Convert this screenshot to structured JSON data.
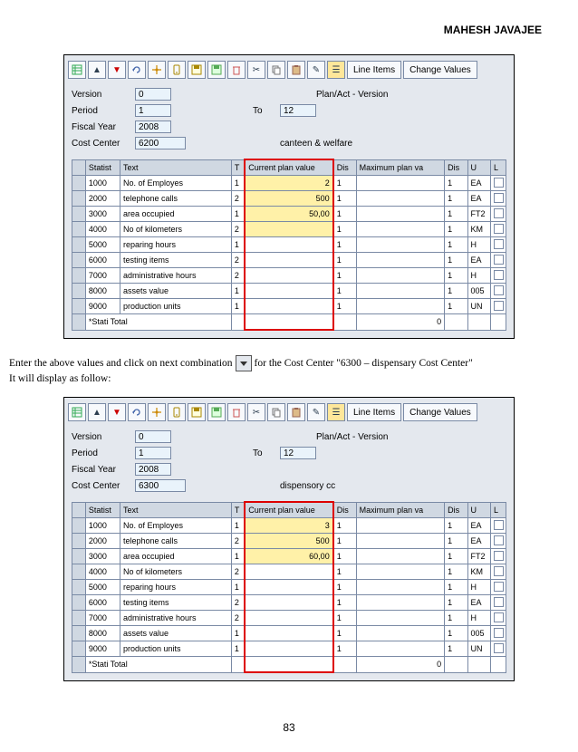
{
  "header": {
    "author": "MAHESH JAVAJEE"
  },
  "footer": {
    "page_number": "83"
  },
  "toolbar": {
    "line_items": "Line Items",
    "change_values": "Change Values"
  },
  "form": {
    "labels": {
      "version": "Version",
      "period": "Period",
      "fiscal_year": "Fiscal Year",
      "cost_center": "Cost Center",
      "to": "To",
      "planact": "Plan/Act - Version"
    }
  },
  "grid_headers": {
    "statist": "Statist",
    "text": "Text",
    "t": "T",
    "cpv": "Current plan value",
    "dis1": "Dis",
    "maxpv": "Maximum plan va",
    "dis2": "Dis",
    "u": "U",
    "l": "L"
  },
  "screen1": {
    "version": "0",
    "period_from": "1",
    "period_to": "12",
    "fiscal_year": "2008",
    "cost_center": "6200",
    "cost_center_text": "canteen & welfare",
    "rows": [
      {
        "id": "1000",
        "text": "No. of Employes",
        "t": "1",
        "cpv": "2",
        "dis1": "1",
        "max": "",
        "dis2": "1",
        "u": "EA",
        "l": ""
      },
      {
        "id": "2000",
        "text": "telephone calls",
        "t": "2",
        "cpv": "500",
        "dis1": "1",
        "max": "",
        "dis2": "1",
        "u": "EA",
        "l": ""
      },
      {
        "id": "3000",
        "text": "area occupied",
        "t": "1",
        "cpv": "50,00",
        "dis1": "1",
        "max": "",
        "dis2": "1",
        "u": "FT2",
        "l": ""
      },
      {
        "id": "4000",
        "text": "No of kilometers",
        "t": "2",
        "cpv": "",
        "dis1": "1",
        "max": "",
        "dis2": "1",
        "u": "KM",
        "l": ""
      },
      {
        "id": "5000",
        "text": "reparing hours",
        "t": "1",
        "cpv": "",
        "dis1": "1",
        "max": "",
        "dis2": "1",
        "u": "H",
        "l": ""
      },
      {
        "id": "6000",
        "text": "testing items",
        "t": "2",
        "cpv": "",
        "dis1": "1",
        "max": "",
        "dis2": "1",
        "u": "EA",
        "l": ""
      },
      {
        "id": "7000",
        "text": "administrative hours",
        "t": "2",
        "cpv": "",
        "dis1": "1",
        "max": "",
        "dis2": "1",
        "u": "H",
        "l": ""
      },
      {
        "id": "8000",
        "text": "assets value",
        "t": "1",
        "cpv": "",
        "dis1": "1",
        "max": "",
        "dis2": "1",
        "u": "005",
        "l": ""
      },
      {
        "id": "9000",
        "text": "production units",
        "t": "1",
        "cpv": "",
        "dis1": "1",
        "max": "",
        "dis2": "1",
        "u": "UN",
        "l": ""
      }
    ],
    "total_label": "*Stati Total",
    "total_value": "0"
  },
  "instruction": {
    "line1a": "Enter the above values and click on next combination",
    "line1b": "for the Cost Center \"6300 – dispensary Cost Center\"",
    "line2": "It will display as follow:"
  },
  "screen2": {
    "version": "0",
    "period_from": "1",
    "period_to": "12",
    "fiscal_year": "2008",
    "cost_center": "6300",
    "cost_center_text": "dispensory cc",
    "rows": [
      {
        "id": "1000",
        "text": "No. of Employes",
        "t": "1",
        "cpv": "3",
        "dis1": "1",
        "max": "",
        "dis2": "1",
        "u": "EA",
        "l": ""
      },
      {
        "id": "2000",
        "text": "telephone calls",
        "t": "2",
        "cpv": "500",
        "dis1": "1",
        "max": "",
        "dis2": "1",
        "u": "EA",
        "l": ""
      },
      {
        "id": "3000",
        "text": "area occupied",
        "t": "1",
        "cpv": "60,00",
        "dis1": "1",
        "max": "",
        "dis2": "1",
        "u": "FT2",
        "l": ""
      },
      {
        "id": "4000",
        "text": "No of kilometers",
        "t": "2",
        "cpv": "",
        "dis1": "1",
        "max": "",
        "dis2": "1",
        "u": "KM",
        "l": ""
      },
      {
        "id": "5000",
        "text": "reparing hours",
        "t": "1",
        "cpv": "",
        "dis1": "1",
        "max": "",
        "dis2": "1",
        "u": "H",
        "l": ""
      },
      {
        "id": "6000",
        "text": "testing items",
        "t": "2",
        "cpv": "",
        "dis1": "1",
        "max": "",
        "dis2": "1",
        "u": "EA",
        "l": ""
      },
      {
        "id": "7000",
        "text": "administrative hours",
        "t": "2",
        "cpv": "",
        "dis1": "1",
        "max": "",
        "dis2": "1",
        "u": "H",
        "l": ""
      },
      {
        "id": "8000",
        "text": "assets value",
        "t": "1",
        "cpv": "",
        "dis1": "1",
        "max": "",
        "dis2": "1",
        "u": "005",
        "l": ""
      },
      {
        "id": "9000",
        "text": "production units",
        "t": "1",
        "cpv": "",
        "dis1": "1",
        "max": "",
        "dis2": "1",
        "u": "UN",
        "l": ""
      }
    ],
    "total_label": "*Stati Total",
    "total_value": "0"
  }
}
